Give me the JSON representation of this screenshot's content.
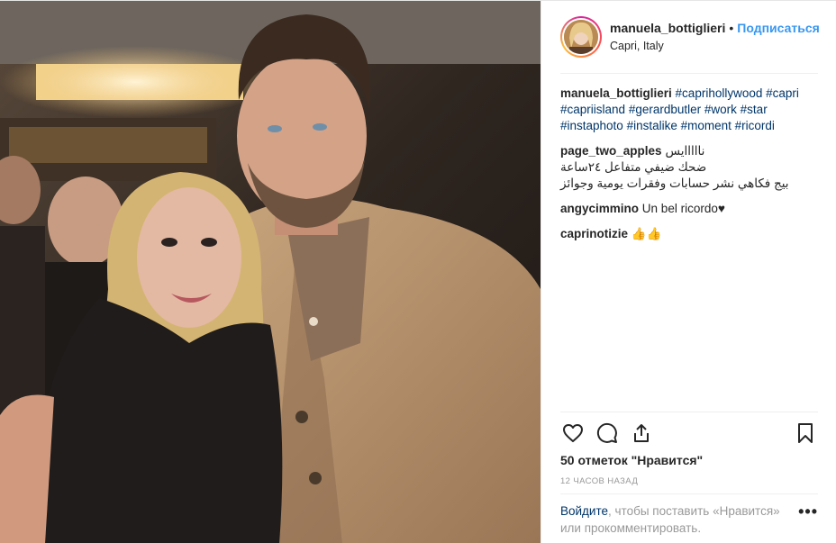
{
  "post": {
    "username": "manuela_bottiglieri",
    "separator": "•",
    "follow_label": "Подписаться",
    "location": "Capri, Italy"
  },
  "caption": {
    "username": "manuela_bottiglieri",
    "hashtags": [
      "#caprihollywood",
      "#capri",
      "#capriisland",
      "#gerardbutler",
      "#work",
      "#star",
      "#instaphoto",
      "#instalike",
      "#moment",
      "#ricordi"
    ]
  },
  "comments": [
    {
      "username": "page_two_apples",
      "text_line1": "نااااايس",
      "text_line2": "ضحك ضيفي متفاعل ٢٤ساعة",
      "text_line3": "بيج فكاهي نشر حسابات وفقرات يومية وجوائز"
    },
    {
      "username": "angycimmino",
      "text": "Un bel ricordo♥"
    },
    {
      "username": "caprinotizie",
      "text": "👍👍"
    }
  ],
  "actions": {
    "icons": [
      "heart-icon",
      "comment-icon",
      "share-icon",
      "bookmark-icon"
    ]
  },
  "likes_text": "50 отметок \"Нравится\"",
  "timestamp": "12 ЧАСОВ НАЗАД",
  "login": {
    "link_label": "Войдите",
    "rest": ", чтобы поставить «Нравится» или прокомментировать."
  },
  "more_label": "•••",
  "colors": {
    "link_blue": "#3897f0",
    "hashtag": "#003569",
    "muted": "#999999",
    "text": "#262626"
  }
}
